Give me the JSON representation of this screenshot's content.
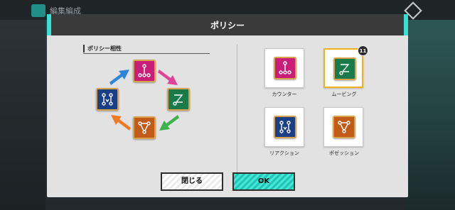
{
  "background": {
    "title": "編集編成"
  },
  "dialog": {
    "title": "ポリシー",
    "section_label": "ポリシー相性",
    "cycle": {
      "nodes": [
        {
          "name": "counter",
          "color": "#c81e78"
        },
        {
          "name": "moving",
          "color": "#1a7a4a"
        },
        {
          "name": "position",
          "color": "#c25a18"
        },
        {
          "name": "reaction",
          "color": "#1b3f84"
        }
      ],
      "arrow_colors": [
        "#e0449a",
        "#3cb24a",
        "#f07a24",
        "#2f86d8"
      ]
    },
    "policies": [
      {
        "label": "カウンター",
        "color": "#c81e78",
        "selected": false
      },
      {
        "label": "ムービング",
        "color": "#1a7a4a",
        "selected": true,
        "badge": "11"
      },
      {
        "label": "リアクション",
        "color": "#1b3f84",
        "selected": false
      },
      {
        "label": "ポゼッション",
        "color": "#c25a18",
        "selected": false
      }
    ]
  },
  "buttons": {
    "close": "閉じる",
    "ok": "OK"
  }
}
